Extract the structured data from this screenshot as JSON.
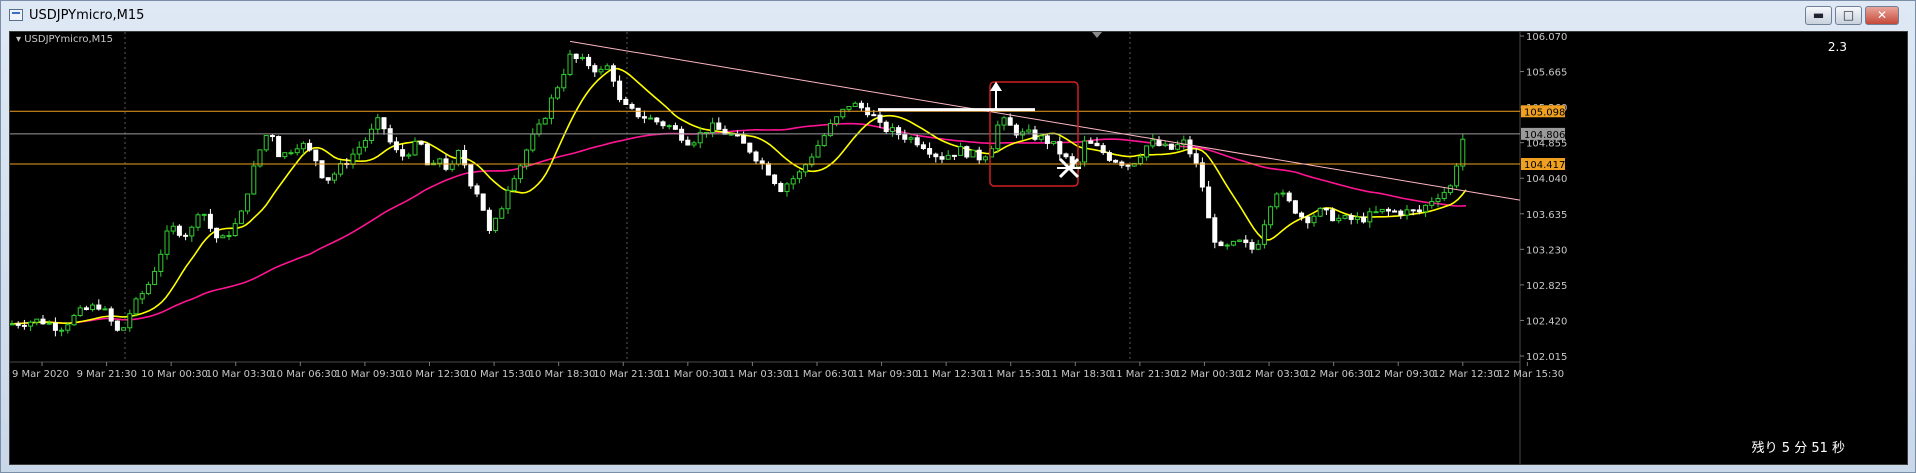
{
  "window": {
    "title": "USDJPYmicro,M15",
    "buttons": [
      "minimize",
      "maximize",
      "close"
    ]
  },
  "chart": {
    "symbol_label": "USDJPYmicro,M15",
    "spread": "2.3",
    "countdown": "残り 5 分 51 秒",
    "price_labels": [
      "106.070",
      "105.665",
      "105.260",
      "104.855",
      "104.040",
      "103.635",
      "103.230",
      "102.825",
      "102.420",
      "102.015"
    ],
    "time_labels": [
      "9 Mar 2020",
      "9 Mar 21:30",
      "10 Mar 00:30",
      "10 Mar 03:30",
      "10 Mar 06:30",
      "10 Mar 09:30",
      "10 Mar 12:30",
      "10 Mar 15:30",
      "10 Mar 18:30",
      "10 Mar 21:30",
      "11 Mar 00:30",
      "11 Mar 03:30",
      "11 Mar 06:30",
      "11 Mar 09:30",
      "11 Mar 12:30",
      "11 Mar 15:30",
      "11 Mar 18:30",
      "11 Mar 21:30",
      "12 Mar 00:30",
      "12 Mar 03:30",
      "12 Mar 06:30",
      "12 Mar 09:30",
      "12 Mar 12:30",
      "12 Mar 15:30"
    ],
    "hlines": [
      {
        "price": 105.098,
        "label": "105.098",
        "color": "#f0a020"
      },
      {
        "price": 104.806,
        "label": "104.806",
        "color": "#9a9a9a"
      },
      {
        "price": 104.417,
        "label": "104.417",
        "color": "#f0a020"
      }
    ],
    "colors": {
      "up": "#32cd32",
      "down": "#ffffff",
      "ma_fast": "#ffff00",
      "ma_slow": "#ff1493",
      "trend": "#ffb6c1"
    }
  },
  "chart_data": {
    "type": "candlestick",
    "symbol": "USDJPYmicro",
    "timeframe": "M15",
    "ylim": [
      102.015,
      106.07
    ],
    "close_path": [
      [
        0,
        102.35
      ],
      [
        30,
        102.4
      ],
      [
        50,
        102.3
      ],
      [
        70,
        102.5
      ],
      [
        90,
        102.6
      ],
      [
        110,
        102.2
      ],
      [
        120,
        102.5
      ],
      [
        140,
        102.9
      ],
      [
        160,
        103.6
      ],
      [
        180,
        103.5
      ],
      [
        190,
        103.9
      ],
      [
        200,
        103.6
      ],
      [
        210,
        103.4
      ],
      [
        230,
        103.7
      ],
      [
        240,
        104.2
      ],
      [
        250,
        104.6
      ],
      [
        260,
        104.9
      ],
      [
        270,
        104.5
      ],
      [
        290,
        104.7
      ],
      [
        305,
        104.5
      ],
      [
        315,
        104.2
      ],
      [
        325,
        104.3
      ],
      [
        340,
        104.5
      ],
      [
        360,
        104.8
      ],
      [
        370,
        105.0
      ],
      [
        380,
        104.7
      ],
      [
        390,
        104.5
      ],
      [
        410,
        104.7
      ],
      [
        420,
        104.3
      ],
      [
        430,
        104.5
      ],
      [
        440,
        104.3
      ],
      [
        450,
        104.6
      ],
      [
        460,
        104.2
      ],
      [
        470,
        104.0
      ],
      [
        480,
        103.5
      ],
      [
        490,
        103.8
      ],
      [
        500,
        104.2
      ],
      [
        510,
        104.4
      ],
      [
        520,
        104.7
      ],
      [
        530,
        104.9
      ],
      [
        540,
        105.2
      ],
      [
        550,
        105.5
      ],
      [
        560,
        105.8
      ],
      [
        580,
        105.7
      ],
      [
        590,
        105.6
      ],
      [
        600,
        105.7
      ],
      [
        610,
        105.2
      ],
      [
        620,
        105.1
      ],
      [
        640,
        105.0
      ],
      [
        660,
        104.9
      ],
      [
        680,
        104.7
      ],
      [
        700,
        104.9
      ],
      [
        720,
        104.8
      ],
      [
        740,
        104.6
      ],
      [
        760,
        104.3
      ],
      [
        770,
        104.1
      ],
      [
        790,
        104.3
      ],
      [
        800,
        104.5
      ],
      [
        820,
        104.9
      ],
      [
        840,
        105.2
      ],
      [
        860,
        105.1
      ],
      [
        870,
        104.9
      ],
      [
        890,
        104.8
      ],
      [
        910,
        104.7
      ],
      [
        920,
        104.6
      ],
      [
        930,
        104.5
      ],
      [
        950,
        104.6
      ],
      [
        970,
        104.5
      ],
      [
        980,
        104.6
      ],
      [
        990,
        105.0
      ],
      [
        1000,
        104.9
      ],
      [
        1010,
        104.8
      ],
      [
        1020,
        104.8
      ],
      [
        1040,
        104.7
      ],
      [
        1055,
        104.5
      ],
      [
        1065,
        104.3
      ],
      [
        1075,
        104.7
      ],
      [
        1090,
        104.6
      ],
      [
        1100,
        104.5
      ],
      [
        1120,
        104.4
      ],
      [
        1140,
        104.7
      ],
      [
        1160,
        104.6
      ],
      [
        1175,
        104.7
      ],
      [
        1190,
        104.3
      ],
      [
        1200,
        103.6
      ],
      [
        1210,
        103.3
      ],
      [
        1230,
        103.4
      ],
      [
        1245,
        103.3
      ],
      [
        1255,
        103.7
      ],
      [
        1265,
        104.1
      ],
      [
        1280,
        103.9
      ],
      [
        1295,
        103.7
      ],
      [
        1310,
        103.8
      ],
      [
        1330,
        103.7
      ],
      [
        1350,
        103.7
      ],
      [
        1370,
        103.8
      ],
      [
        1390,
        103.8
      ],
      [
        1410,
        103.8
      ],
      [
        1425,
        104.0
      ],
      [
        1440,
        104.1
      ],
      [
        1450,
        104.6
      ],
      [
        1456,
        104.9
      ]
    ]
  }
}
